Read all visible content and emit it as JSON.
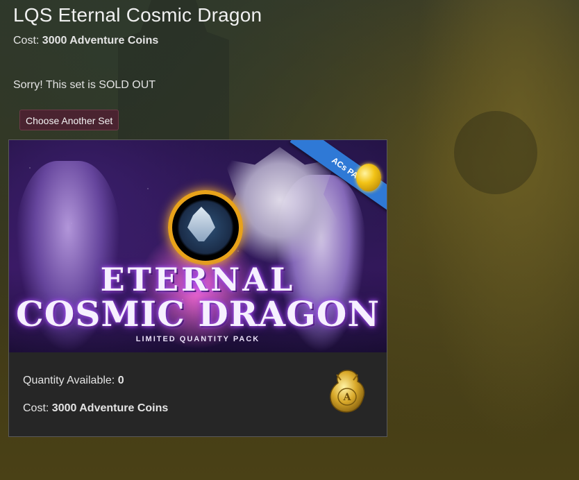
{
  "page": {
    "title": "LQS Eternal Cosmic Dragon",
    "cost_label": "Cost:",
    "cost_value": "3000 Adventure Coins",
    "sold_out_message": "Sorry! This set is SOLD OUT"
  },
  "actions": {
    "choose_another_label": "Choose Another Set"
  },
  "banner": {
    "title_line1": "ETERNAL",
    "title_line2": "COSMIC DRAGON",
    "subtitle": "LIMITED QUANTITY PACK",
    "ribbon_label": "ACs PACK"
  },
  "details": {
    "quantity_label": "Quantity Available:",
    "quantity_value": "0",
    "cost_label": "Cost:",
    "cost_value": "3000 Adventure Coins"
  },
  "icons": {
    "currency": "adventure-coin-dragon-icon"
  },
  "colors": {
    "button_bg": "#4a2330",
    "card_bg": "#262626",
    "ribbon": "#2f79d6",
    "gold": "#e8a21a"
  }
}
